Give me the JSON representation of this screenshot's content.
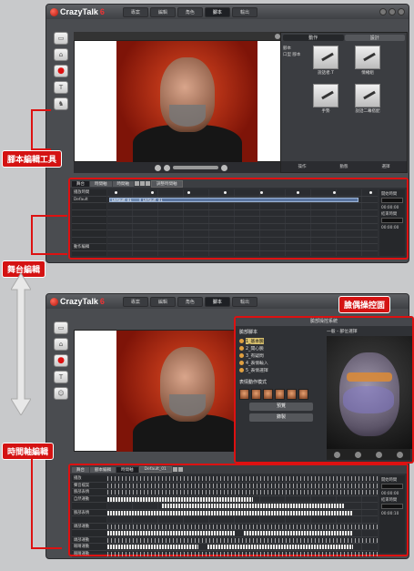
{
  "app": {
    "name": "CrazyTalk",
    "version": "6"
  },
  "menu": {
    "tabs": [
      "專案",
      "編輯",
      "角色",
      "腳本",
      "輸出"
    ],
    "active": "腳本"
  },
  "top_right_tabs": [
    "動作",
    "設計"
  ],
  "tree": [
    "腳本",
    "口型 腳本"
  ],
  "thumbs": [
    "說話者.T",
    "情緒組",
    "手勢",
    "說話二幕搭配",
    "",
    ""
  ],
  "right_bottom": [
    "操作",
    "動態",
    "選擇"
  ],
  "timeline1": {
    "tabs": [
      "舞台",
      "時間軸",
      "時間軸"
    ],
    "button": "調整時間軸",
    "labels": [
      "播放時間",
      "Default",
      "",
      "",
      "",
      "",
      "",
      "",
      "",
      "",
      "",
      "動作編輯"
    ],
    "clips": [
      "Default_01",
      "Default_01"
    ],
    "right": [
      "開始時間",
      "00:00:00",
      "結束時間",
      "00:00:00"
    ]
  },
  "timeline2": {
    "tabs": [
      "舞台",
      "腳本編輯",
      "時間軸"
    ],
    "select": "Default_01",
    "labels": [
      "播放",
      "聲音檔案",
      "臉部表情",
      "自然運動",
      "",
      "臉部表情",
      "",
      "頭部運動",
      "",
      "頭部運動",
      "眼睛運動",
      "眼睛運動",
      "頭部運動",
      "嘴型方塊",
      "身體上下擺動"
    ],
    "right": [
      "開始時間",
      "00:00:00",
      "結束時間",
      "00:00:10"
    ]
  },
  "face_dialog": {
    "title": "臉部操控系統",
    "list_header": "臉部腳本",
    "items": [
      "1_基本臉",
      "2_開心臉",
      "3_有疑問",
      "4_表情輸入",
      "5_表情選擇"
    ],
    "selected": 0,
    "expr_header": "表情動作模式",
    "right_header": "一般 - 部位選擇",
    "buttons": [
      "預覽",
      "錄製"
    ]
  },
  "callouts": {
    "script_tools": "腳本編輯工具",
    "stage_edit": "舞台編輯",
    "timeline_edit": "時間軸編輯",
    "puppet": "臉偶操控面"
  },
  "colors": {
    "accent": "#d41212",
    "panel": "#4a4c50",
    "dark": "#2e3034"
  }
}
